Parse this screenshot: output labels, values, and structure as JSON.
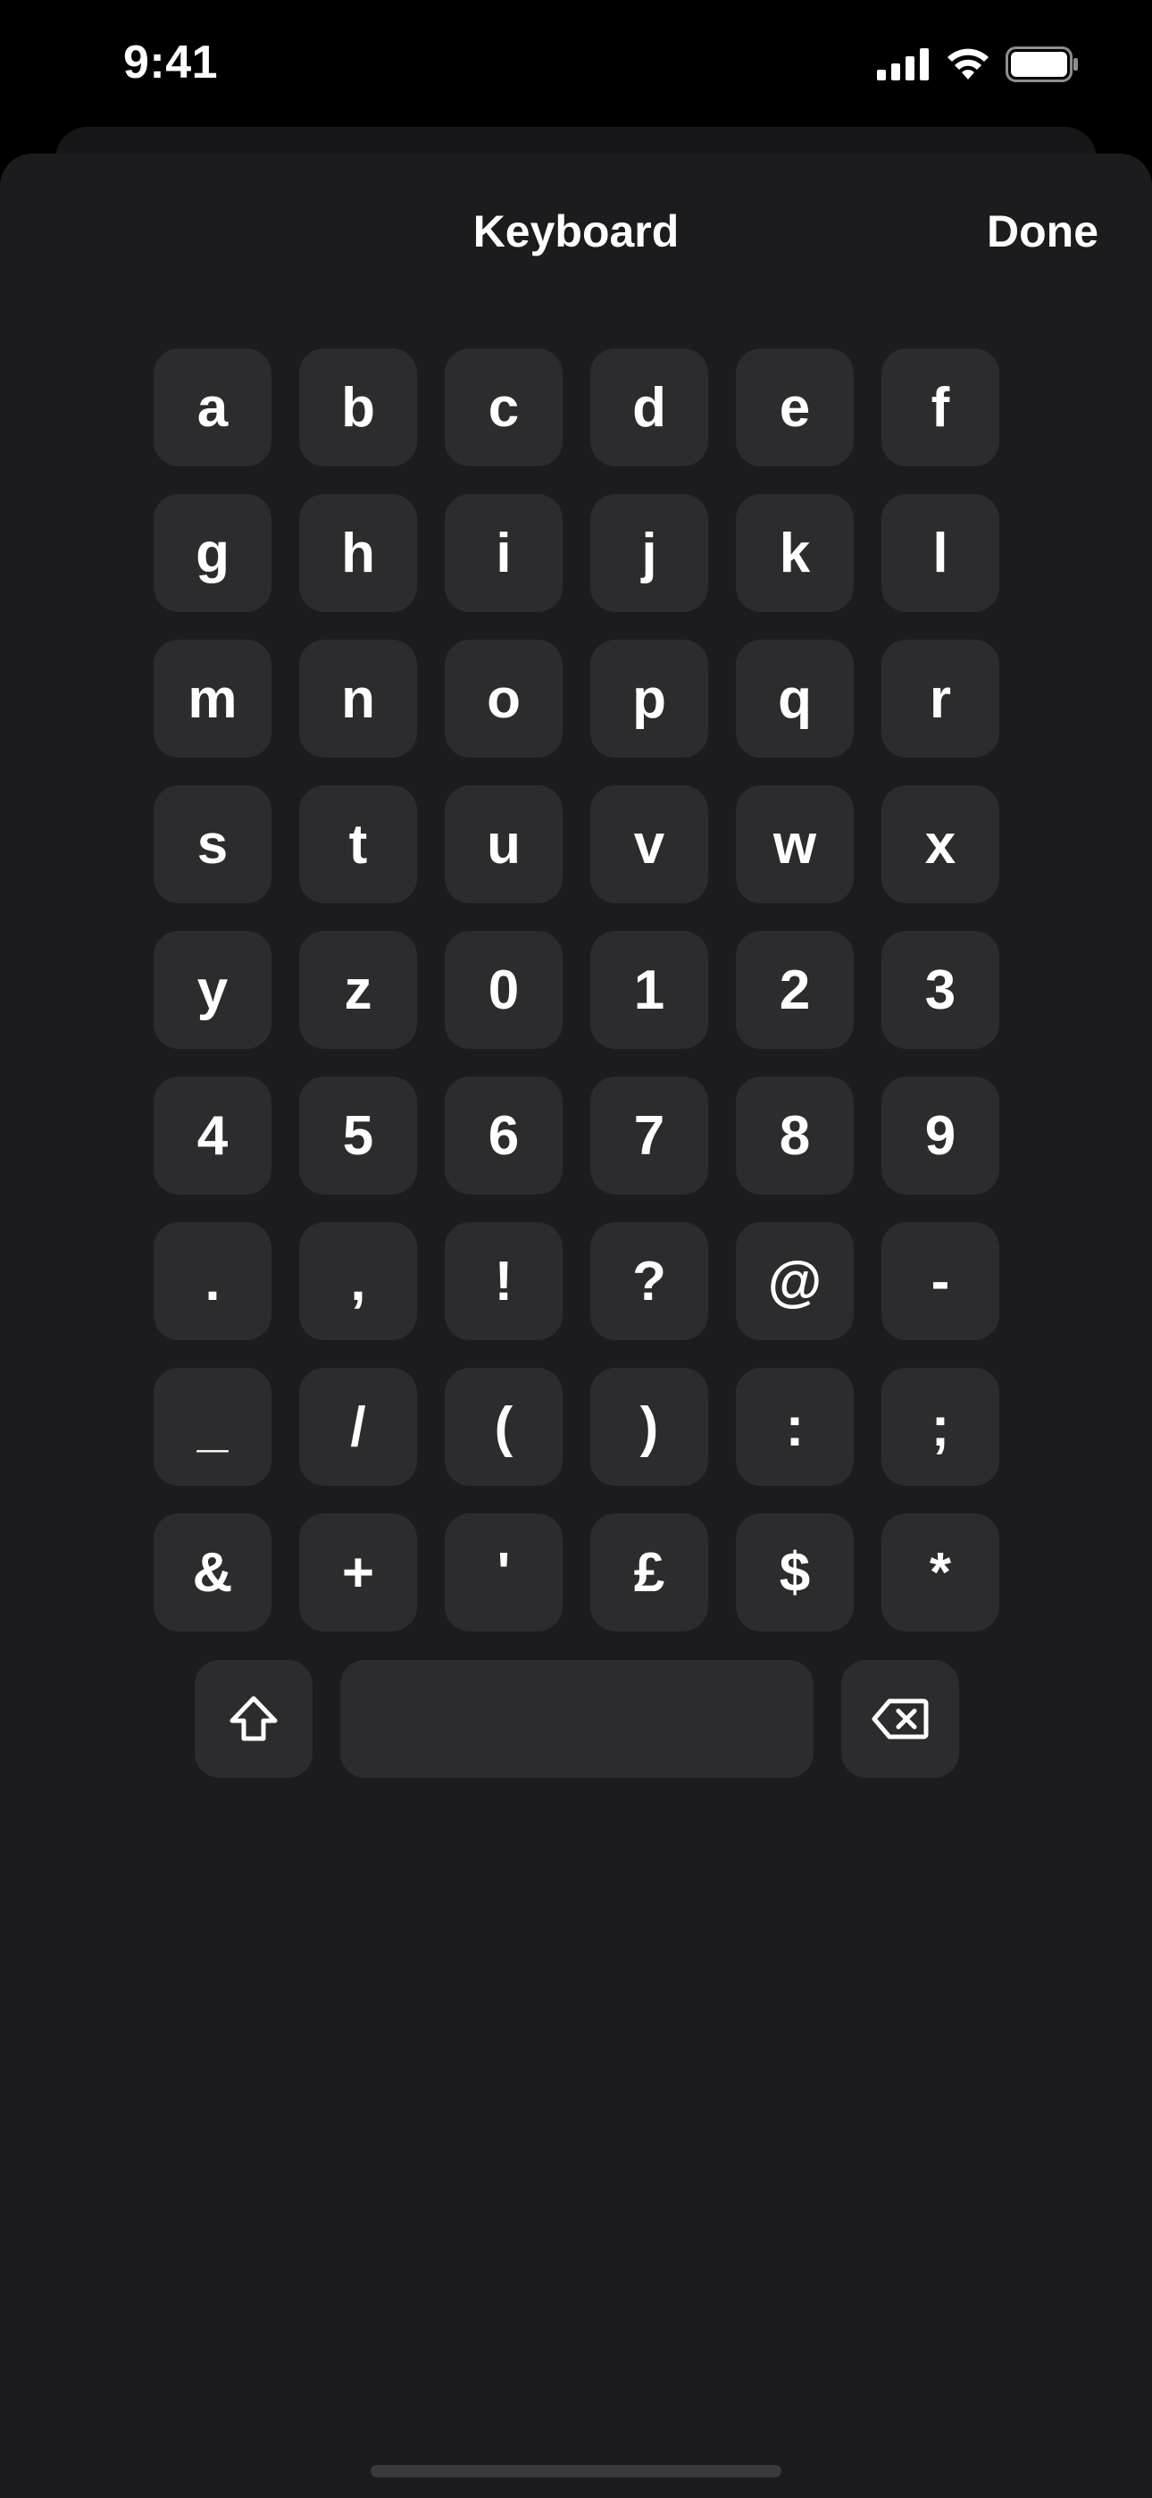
{
  "status_bar": {
    "time": "9:41",
    "icons": [
      "cellular-signal-icon",
      "wifi-icon",
      "battery-icon"
    ]
  },
  "sheet": {
    "title": "Keyboard",
    "done_label": "Done"
  },
  "keys": [
    "a",
    "b",
    "c",
    "d",
    "e",
    "f",
    "g",
    "h",
    "i",
    "j",
    "k",
    "l",
    "m",
    "n",
    "o",
    "p",
    "q",
    "r",
    "s",
    "t",
    "u",
    "v",
    "w",
    "x",
    "y",
    "z",
    "0",
    "1",
    "2",
    "3",
    "4",
    "5",
    "6",
    "7",
    "8",
    "9",
    ".",
    ",",
    "!",
    "?",
    "@",
    "-",
    "_",
    "/",
    "(",
    ")",
    ":",
    ";",
    "&",
    "+",
    "'",
    "£",
    "$",
    "*"
  ],
  "bottom_row": {
    "left_key_icon": "shift-icon",
    "middle_key": "space",
    "right_key_icon": "delete-icon"
  },
  "colors": {
    "background": "#000000",
    "sheet": "#1c1c1e",
    "key": "#2c2c2e",
    "text": "#ffffff"
  }
}
